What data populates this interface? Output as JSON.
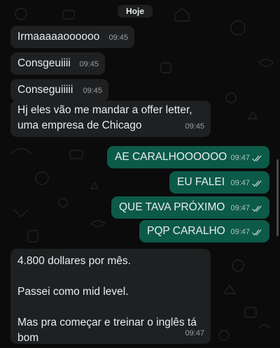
{
  "date_separator": "Hoje",
  "messages": [
    {
      "direction": "incoming",
      "text": "Irmaaaaaoooooo",
      "time": "09:45"
    },
    {
      "direction": "incoming",
      "text": "Consgeuiiii",
      "time": "09:45"
    },
    {
      "direction": "incoming",
      "text": "Conseguiiiii",
      "time": "09:45"
    },
    {
      "direction": "incoming",
      "text": "Hj eles vão me mandar a offer letter, uma empresa de Chicago",
      "time": "09:45"
    },
    {
      "direction": "outgoing",
      "text": "AE CARALHOOOOOO",
      "time": "09:47",
      "status": "read"
    },
    {
      "direction": "outgoing",
      "text": "EU FALEI",
      "time": "09:47",
      "status": "read"
    },
    {
      "direction": "outgoing",
      "text": "QUE TAVA PRÓXIMO",
      "time": "09:47",
      "status": "read"
    },
    {
      "direction": "outgoing",
      "text": "PQP CARALHO",
      "time": "09:47",
      "status": "read"
    },
    {
      "direction": "incoming",
      "text": "4.800 dollares por mês.\n\nPassei como mid level.\n\nMas pra começar e treinar o inglês tá bom",
      "time": "09:47"
    }
  ],
  "colors": {
    "background": "#0b0b0b",
    "incoming_bubble": "#1f2021",
    "outgoing_bubble": "#0c5a48",
    "text": "#e9edef"
  },
  "icons": [
    "double-check-icon"
  ]
}
